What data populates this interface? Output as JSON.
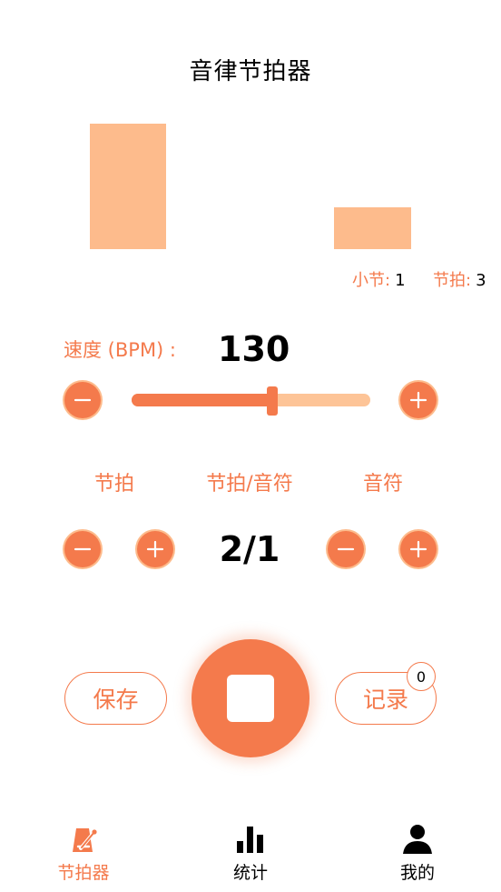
{
  "header": {
    "title": "音律节拍器"
  },
  "beat_visual": {
    "beats_shown": 2
  },
  "counters": {
    "measure_label": "小节:",
    "measure_value": "1",
    "beat_label": "节拍:",
    "beat_value": "3"
  },
  "tempo": {
    "label": "速度 (BPM) :",
    "value": "130",
    "slider_fraction": 0.59
  },
  "time_signature": {
    "beats_label": "节拍",
    "center_label": "节拍/音符",
    "note_label": "音符",
    "value": "2/1"
  },
  "actions": {
    "save_label": "保存",
    "record_label": "记录",
    "record_count": "0"
  },
  "nav": {
    "items": [
      {
        "label": "节拍器",
        "icon": "metronome-icon",
        "active": true
      },
      {
        "label": "统计",
        "icon": "bar-chart-icon",
        "active": false
      },
      {
        "label": "我的",
        "icon": "user-icon",
        "active": false
      }
    ]
  },
  "colors": {
    "accent": "#f47a4c",
    "accent_light": "#fdbb8c"
  }
}
